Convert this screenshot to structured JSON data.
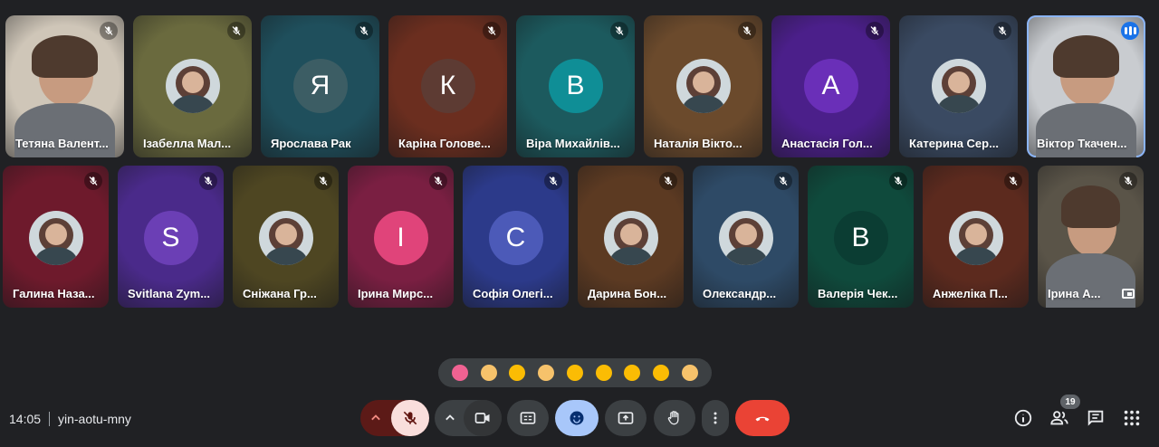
{
  "participants_row1": [
    {
      "name": "Тетяна Валент...",
      "type": "video",
      "bg": "#cfc6b8",
      "badge": "muted"
    },
    {
      "name": "Ізабелла Мал...",
      "type": "photo",
      "bg": "#6a6a3e",
      "badge": "muted"
    },
    {
      "name": "Ярослава Рак",
      "type": "letter",
      "letter": "Я",
      "bg": "#1f4f5c",
      "avatar": "#3c5d64",
      "badge": "muted"
    },
    {
      "name": "Каріна Голове...",
      "type": "letter",
      "letter": "К",
      "bg": "#6b2e1f",
      "avatar": "#5d3b33",
      "badge": "muted"
    },
    {
      "name": "Віра Михайлів...",
      "type": "letter",
      "letter": "В",
      "bg": "#1c5a5e",
      "avatar": "#0f8e96",
      "badge": "muted"
    },
    {
      "name": "Наталія Вікто...",
      "type": "photo",
      "bg": "#6b4a2c",
      "badge": "muted"
    },
    {
      "name": "Анастасія Гол...",
      "type": "letter",
      "letter": "А",
      "bg": "#4b1f8a",
      "avatar": "#6a2fb8",
      "badge": "muted"
    },
    {
      "name": "Катерина Сер...",
      "type": "photo",
      "bg": "#3a4a62",
      "badge": "muted"
    },
    {
      "name": "Віктор Ткачен...",
      "type": "video",
      "bg": "#c9ccd0",
      "badge": "speaking"
    }
  ],
  "participants_row2": [
    {
      "name": "Галина Наза...",
      "type": "photo",
      "bg": "#6e1a2c",
      "badge": "muted"
    },
    {
      "name": "Svitlana Zym...",
      "type": "letter",
      "letter": "S",
      "bg": "#4a2a8a",
      "avatar": "#6b3fb5",
      "badge": "muted"
    },
    {
      "name": "Сніжана Гр...",
      "type": "photo",
      "bg": "#4e4622",
      "badge": "muted"
    },
    {
      "name": "Ірина Мирс...",
      "type": "letter",
      "letter": "І",
      "bg": "#7a1f42",
      "avatar": "#e0447a",
      "badge": "muted"
    },
    {
      "name": "Софія Олегі...",
      "type": "letter",
      "letter": "С",
      "bg": "#2c3a8a",
      "avatar": "#4c5ab8",
      "badge": "muted"
    },
    {
      "name": "Дарина Бон...",
      "type": "photo",
      "bg": "#5c3a22",
      "badge": "muted"
    },
    {
      "name": "Олександр...",
      "type": "photo",
      "bg": "#2e4a66",
      "badge": "muted"
    },
    {
      "name": "Валерія Чек...",
      "type": "letter",
      "letter": "В",
      "bg": "#0f4a3c",
      "avatar": "#0b3d33",
      "badge": "muted"
    },
    {
      "name": "Анжеліка П...",
      "type": "photo",
      "bg": "#5c2a1e",
      "badge": "muted"
    },
    {
      "name": "Ірина А...",
      "type": "video",
      "bg": "#5a5448",
      "badge": "muted",
      "pip": true
    }
  ],
  "reactions": [
    {
      "icon": "sparkling-heart-icon",
      "color": "#f06292"
    },
    {
      "icon": "thumbs-up-icon",
      "color": "#f6c26b"
    },
    {
      "icon": "party-popper-icon",
      "color": "#fbbc04"
    },
    {
      "icon": "clapping-hands-icon",
      "color": "#f6c26b"
    },
    {
      "icon": "tears-of-joy-icon",
      "color": "#fbbc04"
    },
    {
      "icon": "surprised-face-icon",
      "color": "#fbbc04"
    },
    {
      "icon": "crying-face-icon",
      "color": "#fbbc04"
    },
    {
      "icon": "thinking-face-icon",
      "color": "#fbbc04"
    },
    {
      "icon": "thumbs-down-icon",
      "color": "#f6c26b"
    }
  ],
  "meeting": {
    "time": "14:05",
    "code": "yin-aotu-mny"
  },
  "people_count": "19",
  "colors": {
    "end_call": "#ea4335",
    "mic_off_bg": "#f9dedc",
    "emoji_active": "#a8c7fa",
    "speaking": "#1a73e8"
  }
}
